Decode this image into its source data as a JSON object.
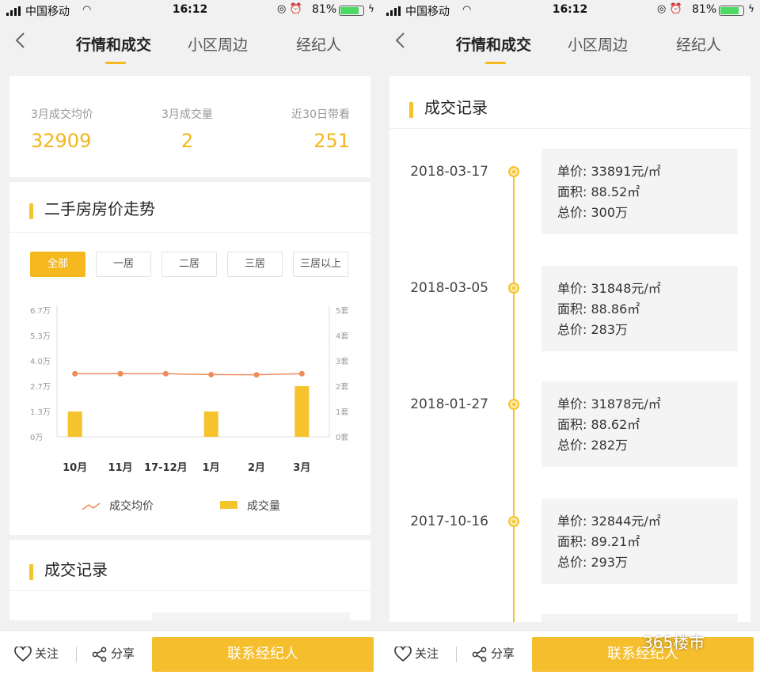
{
  "status": {
    "carrier": "中国移动",
    "time": "16:12",
    "battery": "81%"
  },
  "nav": {
    "tabs": [
      "行情和成交",
      "小区周边",
      "经纪人"
    ]
  },
  "stats": [
    {
      "label": "3月成交均价",
      "value": "32909"
    },
    {
      "label": "3月成交量",
      "value": "2"
    },
    {
      "label": "近30日带看",
      "value": "251"
    }
  ],
  "trend": {
    "title": "二手房房价走势",
    "filters": [
      "全部",
      "一居",
      "二居",
      "三居",
      "三居以上"
    ],
    "active_filter": "全部"
  },
  "chart_data": {
    "type": "bar",
    "categories": [
      "10月",
      "11月",
      "17-12月",
      "1月",
      "2月",
      "3月"
    ],
    "series": [
      {
        "name": "成交均价",
        "type": "line",
        "axis": "left",
        "values": [
          33400,
          33400,
          33400,
          32900,
          32800,
          33400
        ]
      },
      {
        "name": "成交量",
        "type": "bar",
        "axis": "right",
        "values": [
          1,
          0,
          0,
          1,
          0,
          2
        ]
      }
    ],
    "y_left_ticks": [
      "0万",
      "1.3万",
      "2.7万",
      "4.0万",
      "5.3万",
      "6.7万"
    ],
    "y_left_range": [
      0,
      67000
    ],
    "y_right_ticks": [
      "0套",
      "1套",
      "2套",
      "3套",
      "4套",
      "5套"
    ],
    "y_right_range": [
      0,
      5
    ],
    "legend": [
      "成交均价",
      "成交量"
    ],
    "colors": {
      "line": "#ef8a5a",
      "bar": "#f5c32c"
    }
  },
  "records_title": "成交记录",
  "records": [
    {
      "date": "2018-03-17",
      "unit": "单价: 33891元/㎡",
      "area": "面积: 88.52㎡",
      "total": "总价: 300万"
    },
    {
      "date": "2018-03-05",
      "unit": "单价: 31848元/㎡",
      "area": "面积: 88.86㎡",
      "total": "总价: 283万"
    },
    {
      "date": "2018-01-27",
      "unit": "单价: 31878元/㎡",
      "area": "面积: 88.62㎡",
      "total": "总价: 282万"
    },
    {
      "date": "2017-10-16",
      "unit": "单价: 32844元/㎡",
      "area": "面积: 89.21㎡",
      "total": "总价: 293万"
    }
  ],
  "bottom": {
    "follow": "关注",
    "share": "分享",
    "contact": "联系经纪人"
  },
  "watermark": "365楼市"
}
